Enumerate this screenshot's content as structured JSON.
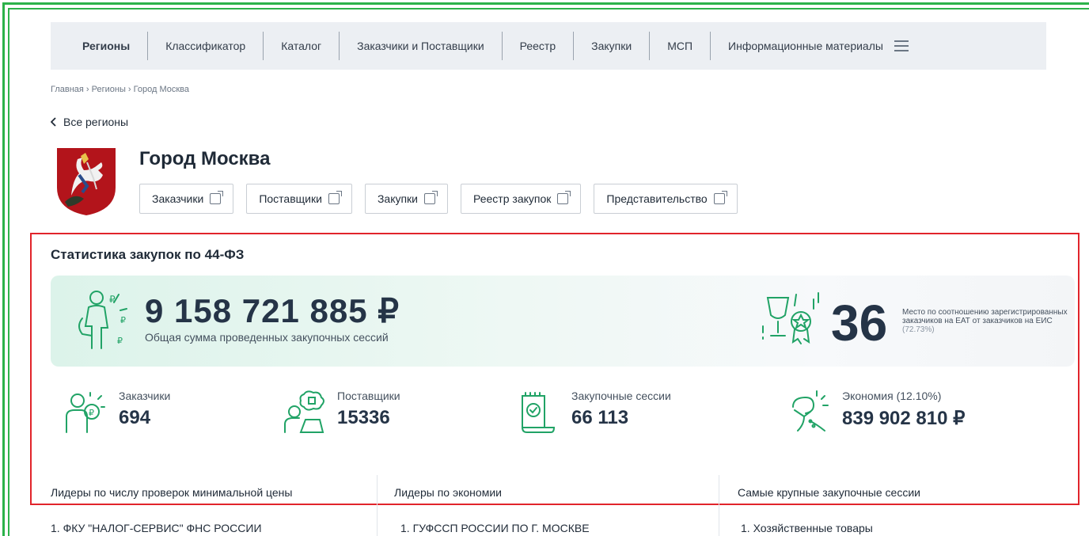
{
  "nav": {
    "items": [
      "Регионы",
      "Классификатор",
      "Каталог",
      "Заказчики и Поставщики",
      "Реестр",
      "Закупки",
      "МСП",
      "Информационные материалы"
    ]
  },
  "breadcrumb": "Главная › Регионы › Город Москва",
  "back_label": "Все регионы",
  "region": {
    "title": "Город Москва",
    "links": [
      "Заказчики",
      "Поставщики",
      "Закупки",
      "Реестр закупок",
      "Представительство"
    ]
  },
  "stats": {
    "title": "Статистика закупок по 44-ФЗ",
    "total_amount": "9 158 721 885 ₽",
    "total_label": "Общая сумма проведенных закупочных сессий",
    "rank": "36",
    "rank_text": "Место по соотношению зарегистрированных заказчиков на ЕАТ от заказчиков на ЕИС",
    "rank_pct": "(72.73%)",
    "kpis": [
      {
        "label": "Заказчики",
        "value": "694"
      },
      {
        "label": "Поставщики",
        "value": "15336"
      },
      {
        "label": "Закупочные сессии",
        "value": "66 113"
      },
      {
        "label": "Экономия (12.10%)",
        "value": "839 902 810 ₽"
      }
    ]
  },
  "leaders": {
    "columns": [
      {
        "title": "Лидеры по числу проверок минимальной цены",
        "first": "1. ФКУ \"НАЛОГ-СЕРВИС\" ФНС РОССИИ"
      },
      {
        "title": "Лидеры по экономии",
        "first": "1. ГУФССП РОССИИ ПО Г. МОСКВЕ"
      },
      {
        "title": "Самые крупные закупочные сессии",
        "first": "1. Хозяйственные товары"
      }
    ]
  },
  "colors": {
    "accent": "#21a366",
    "frame": "#2cb24a",
    "highlight": "#e1242b"
  },
  "icons": [
    "external-link-icon",
    "chevron-left-icon",
    "menu-icon",
    "money-person-icon",
    "trophy-icon",
    "customer-icon",
    "supplier-icon",
    "session-icon",
    "savings-icon"
  ]
}
